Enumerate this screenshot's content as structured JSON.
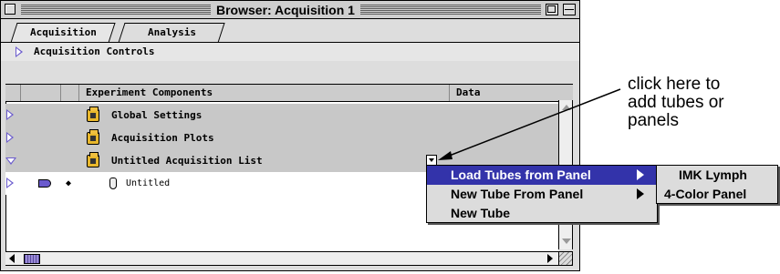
{
  "window": {
    "title": "Browser: Acquisition 1"
  },
  "tabs": [
    {
      "label": "Acquisition",
      "active": true
    },
    {
      "label": "Analysis",
      "active": false
    }
  ],
  "acquisition_controls": {
    "label": "Acquisition Controls"
  },
  "table": {
    "headers": {
      "components": "Experiment Components",
      "data": "Data"
    },
    "rows": [
      {
        "label": "Global Settings",
        "expanded": false
      },
      {
        "label": "Acquisition Plots",
        "expanded": false
      },
      {
        "label": "Untitled Acquisition List",
        "expanded": true
      }
    ],
    "child_row": {
      "label": "Untitled",
      "marker": "◆"
    }
  },
  "popup_menu": {
    "items": [
      {
        "label": "Load Tubes from Panel",
        "highlighted": true,
        "has_submenu": true
      },
      {
        "label": "New Tube From Panel",
        "highlighted": false,
        "has_submenu": true
      },
      {
        "label": "New Tube",
        "highlighted": false,
        "has_submenu": false
      }
    ]
  },
  "submenu": {
    "items": [
      {
        "label": "IMK Lymph"
      },
      {
        "label": "4-Color Panel"
      }
    ]
  },
  "callout": {
    "line1": "click here to",
    "line2": "add tubes or",
    "line3": "panels"
  },
  "colors": {
    "highlight": "#3333aa",
    "disclosure": "#6a5acd",
    "row_gray": "#c8c8c8"
  }
}
